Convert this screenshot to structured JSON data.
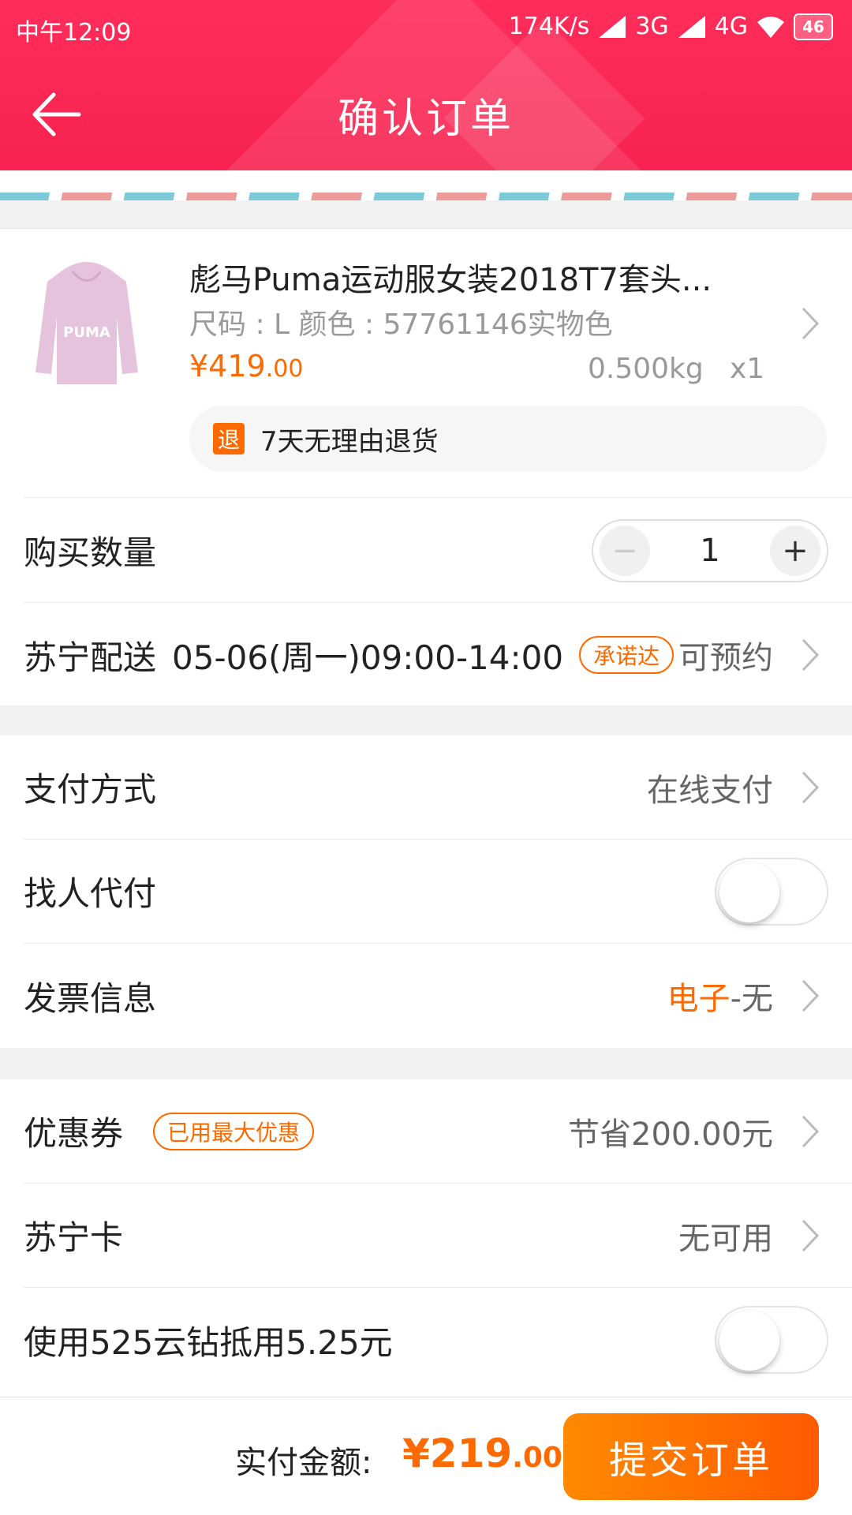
{
  "status_bar": {
    "time": "中午12:09",
    "net_speed": "174K/s",
    "net1": "3G",
    "net2": "4G",
    "battery": "46"
  },
  "header": {
    "title": "确认订单",
    "back_icon": "arrow-left-icon"
  },
  "product": {
    "title": "彪马Puma运动服女装2018T7套头...",
    "spec": "尺码 : L  颜色 : 57761146实物色",
    "price_main": "¥419",
    "price_cents": ".00",
    "weight": "0.500kg",
    "qty": "x1",
    "return_badge": "退",
    "return_text": "7天无理由退货",
    "thumb_brand": "PUMA"
  },
  "quantity": {
    "label": "购买数量",
    "value": "1",
    "minus": "−",
    "plus": "+"
  },
  "delivery": {
    "label": "苏宁配送",
    "time": "05-06(周一)09:00-14:00",
    "tag": "承诺达",
    "value": "可预约"
  },
  "payment": {
    "label": "支付方式",
    "value": "在线支付"
  },
  "proxy_pay": {
    "label": "找人代付",
    "enabled": false
  },
  "invoice": {
    "label": "发票信息",
    "value_highlight": "电子",
    "value_rest": "-无"
  },
  "coupon": {
    "label": "优惠券",
    "tag": "已用最大优惠",
    "value": "节省200.00元"
  },
  "suning_card": {
    "label": "苏宁卡",
    "value": "无可用"
  },
  "diamond": {
    "label": "使用525云钻抵用5.25元",
    "enabled": false
  },
  "footer": {
    "pay_label": "实付金额:",
    "pay_main": "¥219",
    "pay_cents": ".00",
    "submit": "提交订单"
  },
  "colors": {
    "header": "#f7224f",
    "accent": "#ff6a00"
  }
}
